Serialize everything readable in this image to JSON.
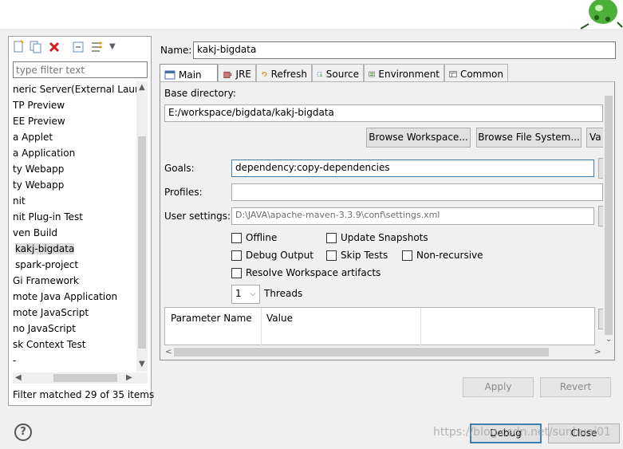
{
  "left": {
    "filter_placeholder": "type filter text",
    "items": [
      {
        "label": "neric Server(External Launcher)",
        "icon": "server-icon"
      },
      {
        "label": "TP Preview",
        "icon": "http-icon"
      },
      {
        "label": "EE Preview",
        "icon": "ee-icon"
      },
      {
        "label": "a Applet",
        "icon": "applet-icon"
      },
      {
        "label": "a Application",
        "icon": "app-icon"
      },
      {
        "label": "ty Webapp",
        "icon": "webapp-icon"
      },
      {
        "label": "ty Webapp",
        "icon": "webapp-icon"
      },
      {
        "label": "nit",
        "icon": "junit-icon"
      },
      {
        "label": "nit Plug-in Test",
        "icon": "junit-icon"
      },
      {
        "label": "ven Build",
        "icon": "maven-icon"
      },
      {
        "label": "kakj-bigdata",
        "icon": "config-icon",
        "selected": true
      },
      {
        "label": "spark-project",
        "icon": "config-icon"
      },
      {
        "label": "Gi Framework",
        "icon": "osgi-icon"
      },
      {
        "label": "mote Java Application",
        "icon": "remote-icon"
      },
      {
        "label": "mote JavaScript",
        "icon": "remote-icon"
      },
      {
        "label": "no JavaScript",
        "icon": "js-icon"
      },
      {
        "label": "sk Context Test",
        "icon": "test-icon"
      },
      {
        "label": "-",
        "icon": "none"
      }
    ],
    "status": "Filter matched 29 of 35 items"
  },
  "config": {
    "name_label": "Name:",
    "name_value": "kakj-bigdata",
    "tabs": [
      {
        "label": "Main",
        "icon": "main-tab-icon"
      },
      {
        "label": "JRE",
        "icon": "jre-tab-icon"
      },
      {
        "label": "Refresh",
        "icon": "refresh-tab-icon"
      },
      {
        "label": "Source",
        "icon": "source-tab-icon"
      },
      {
        "label": "Environment",
        "icon": "environment-tab-icon"
      },
      {
        "label": "Common",
        "icon": "common-tab-icon"
      }
    ],
    "base_dir_label": "Base directory:",
    "base_dir_value": "E:/workspace/bigdata/kakj-bigdata",
    "browse_workspace": "Browse Workspace...",
    "browse_fs": "Browse File System...",
    "variables": "Va",
    "goals_label": "Goals:",
    "goals_value": "dependency:copy-dependencies",
    "profiles_label": "Profiles:",
    "profiles_value": "",
    "user_settings_label": "User settings:",
    "user_settings_value": "D:\\JAVA\\apache-maven-3.3.9\\conf\\settings.xml",
    "checkboxes": {
      "offline": "Offline",
      "update_snapshots": "Update Snapshots",
      "debug_output": "Debug Output",
      "skip_tests": "Skip Tests",
      "non_recursive": "Non-recursive",
      "resolve_workspace": "Resolve Workspace artifacts"
    },
    "threads_value": "1",
    "threads_label": "Threads",
    "table_headers": [
      "Parameter Name",
      "Value"
    ]
  },
  "buttons": {
    "apply": "Apply",
    "revert": "Revert",
    "debug": "Debug",
    "close": "Close",
    "help": "?"
  },
  "watermark": "https://blog.csdn.net/sunhuai01"
}
